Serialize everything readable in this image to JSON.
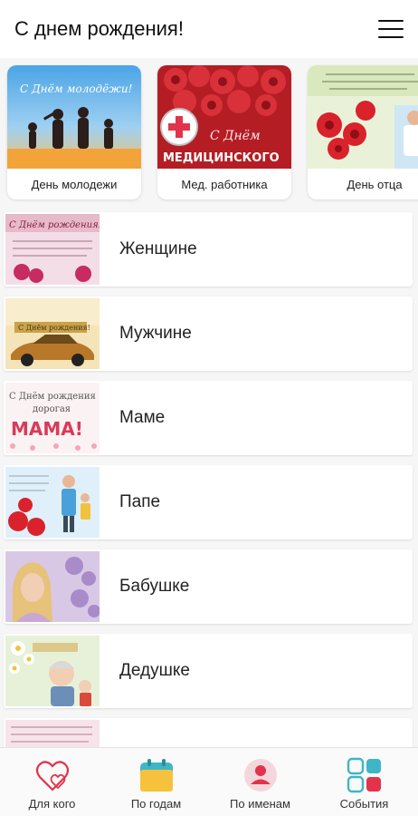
{
  "header": {
    "title": "С днем рождения!",
    "menu_icon": "hamburger-menu-icon"
  },
  "events": [
    {
      "label": "День молодежи",
      "image_text": "С Днём молодёжи!"
    },
    {
      "label": "Мед. работника",
      "image_text_1": "С Днём",
      "image_text_2": "МЕДИЦИНСКОГО"
    },
    {
      "label": "День отца"
    }
  ],
  "categories": [
    {
      "label": "Женщине",
      "image_text": "С Днём рождения!"
    },
    {
      "label": "Мужчине",
      "image_text": "С Днём рождения!"
    },
    {
      "label": "Маме",
      "image_text_1": "С Днём рождения",
      "image_text_2": "дорогая",
      "image_text_3": "МАМА!"
    },
    {
      "label": "Папе"
    },
    {
      "label": "Бабушке"
    },
    {
      "label": "Дедушке"
    }
  ],
  "bottom_nav": [
    {
      "label": "Для кого",
      "icon": "hearts-icon"
    },
    {
      "label": "По годам",
      "icon": "calendar-icon"
    },
    {
      "label": "По именам",
      "icon": "person-icon"
    },
    {
      "label": "События",
      "icon": "grid-icon"
    }
  ],
  "colors": {
    "accent_red": "#e2334b",
    "teal": "#3fb6c7",
    "calendar_yellow": "#f6c23e"
  }
}
